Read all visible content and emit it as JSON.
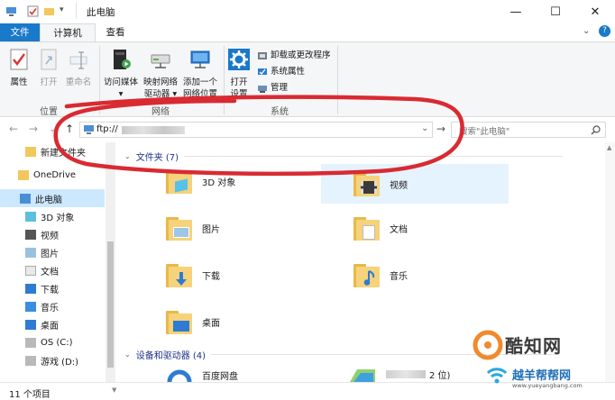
{
  "window": {
    "title": "此电脑",
    "controls": {
      "minimize": "—",
      "maximize": "☐",
      "close": "✕"
    }
  },
  "ribbon_tabs": [
    {
      "label": "文件"
    },
    {
      "label": "计算机"
    },
    {
      "label": "查看"
    }
  ],
  "ribbon": {
    "location_group": {
      "label": "位置",
      "buttons": [
        {
          "label": "属性"
        },
        {
          "label": "打开"
        },
        {
          "label": "重命名"
        }
      ]
    },
    "network_group": {
      "label": "网络",
      "buttons": [
        {
          "label_line1": "访问媒体",
          "label_line2": "▾"
        },
        {
          "label_line1": "映射网络",
          "label_line2": "驱动器 ▾"
        },
        {
          "label_line1": "添加一个",
          "label_line2": "网络位置"
        }
      ]
    },
    "system_group": {
      "label": "系统",
      "open_settings": {
        "label_line1": "打开",
        "label_line2": "设置"
      },
      "items": [
        {
          "label": "卸载或更改程序"
        },
        {
          "label": "系统属性"
        },
        {
          "label": "管理"
        }
      ]
    }
  },
  "navbar": {
    "address_value": "ftp://",
    "search_placeholder": "搜索\"此电脑\"",
    "dropdown_glyph": "⌄",
    "go_glyph": "→",
    "back_glyph": "←",
    "forward_glyph": "→",
    "recent_glyph": "⌄",
    "up_glyph": "↑"
  },
  "sidebar": {
    "items": [
      {
        "label": "新建文件夹"
      },
      {
        "label": "OneDrive"
      },
      {
        "label": "此电脑"
      },
      {
        "label": "3D 对象"
      },
      {
        "label": "视频"
      },
      {
        "label": "图片"
      },
      {
        "label": "文档"
      },
      {
        "label": "下载"
      },
      {
        "label": "音乐"
      },
      {
        "label": "桌面"
      },
      {
        "label": "OS (C:)"
      },
      {
        "label": "游戏 (D:)"
      }
    ]
  },
  "content": {
    "folders_header": "文件夹 (7)",
    "folders": [
      {
        "label": "3D 对象"
      },
      {
        "label": "视频"
      },
      {
        "label": "图片"
      },
      {
        "label": "文档"
      },
      {
        "label": "下载"
      },
      {
        "label": "音乐"
      },
      {
        "label": "桌面"
      }
    ],
    "devices_header": "设备和驱动器 (4)",
    "devices": [
      {
        "label": "百度网盘"
      },
      {
        "label": "2 位)"
      }
    ]
  },
  "status": {
    "text": "11 个项目"
  },
  "watermark": {
    "line1": "酷知网",
    "line2": "越羊帮帮网",
    "url": "www.yueyangbang.com"
  },
  "colors": {
    "accent": "#1979ca",
    "annotation": "#d92a32",
    "folder": "#f6d27a",
    "header_text": "#1e3287"
  }
}
